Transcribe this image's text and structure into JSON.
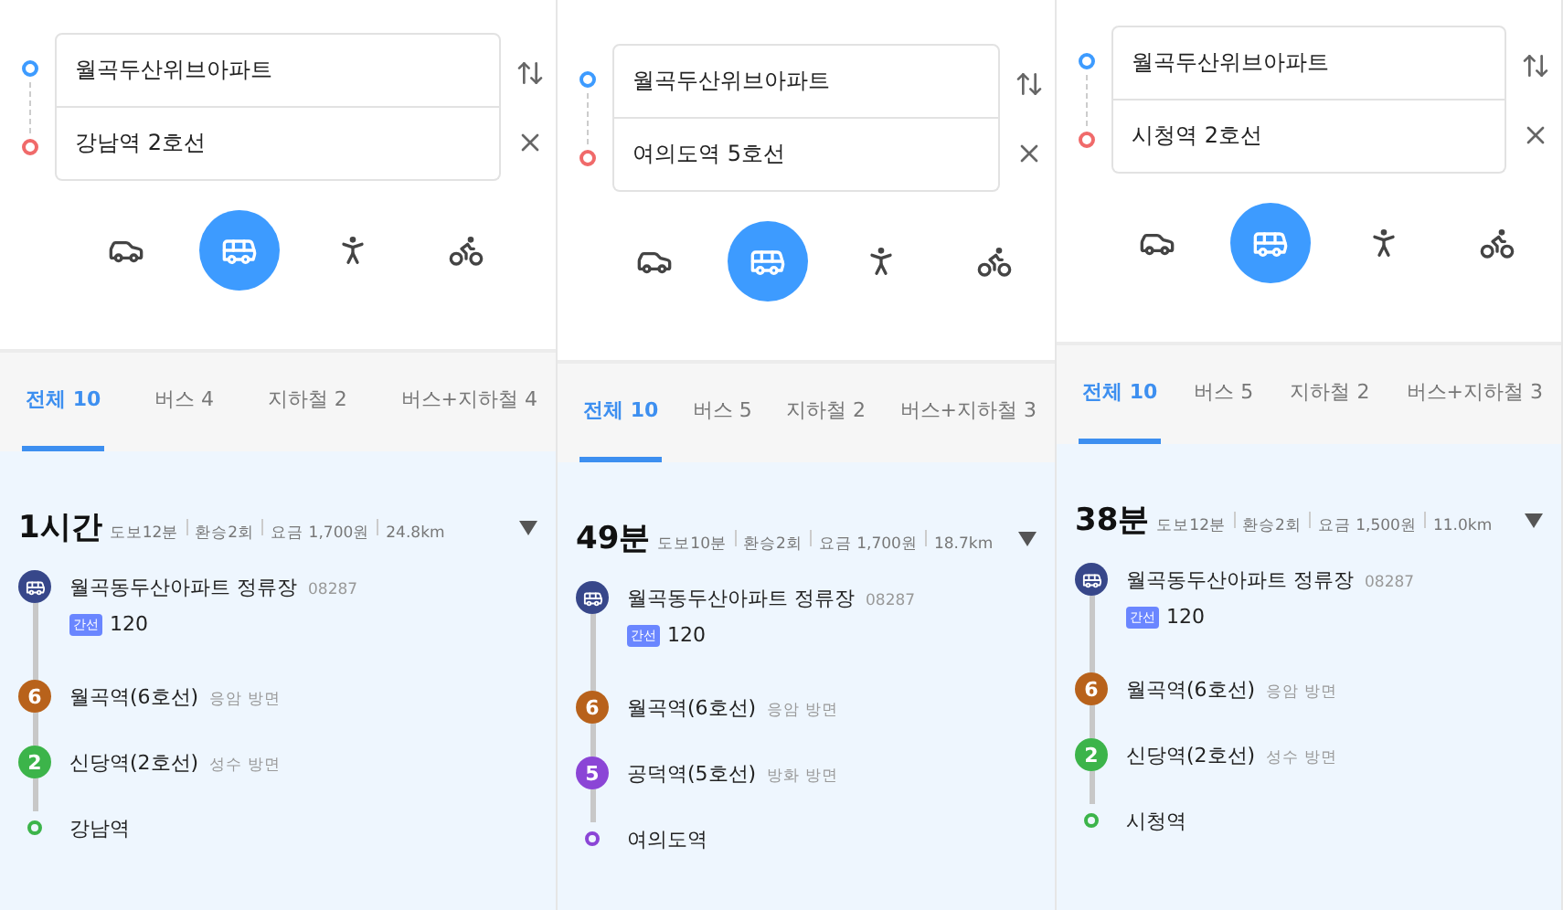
{
  "panels": [
    {
      "origin": "월곡두산위브아파트",
      "destination": "강남역 2호선",
      "modes": [
        {
          "kind": "car",
          "selected": false
        },
        {
          "kind": "transit",
          "selected": true
        },
        {
          "kind": "walk",
          "selected": false
        },
        {
          "kind": "bike",
          "selected": false
        }
      ],
      "tabs": [
        {
          "label": "전체 10",
          "selected": true
        },
        {
          "label": "버스 4",
          "selected": false
        },
        {
          "label": "지하철 2",
          "selected": false
        },
        {
          "label": "버스+지하철 4",
          "selected": false
        }
      ],
      "route": {
        "duration": "1시간",
        "details": [
          "도보12분",
          "환승2회",
          "요금 1,700원",
          "24.8km"
        ],
        "steps": [
          {
            "kind": "bus",
            "name": "월곡동두산아파트 정류장",
            "code": "08287",
            "badge": "간선",
            "number": "120",
            "color": "#37478a"
          },
          {
            "kind": "subway",
            "line": "6",
            "name": "월곡역(6호선)",
            "direction": "응암 방면",
            "color": "#b8621b"
          },
          {
            "kind": "subway",
            "line": "2",
            "name": "신당역(2호선)",
            "direction": "성수 방면",
            "color": "#3cb44a"
          },
          {
            "kind": "end",
            "name": "강남역",
            "color": "#3cb44a"
          }
        ]
      }
    },
    {
      "origin": "월곡두산위브아파트",
      "destination": "여의도역 5호선",
      "modes": [
        {
          "kind": "car",
          "selected": false
        },
        {
          "kind": "transit",
          "selected": true
        },
        {
          "kind": "walk",
          "selected": false
        },
        {
          "kind": "bike",
          "selected": false
        }
      ],
      "tabs": [
        {
          "label": "전체 10",
          "selected": true
        },
        {
          "label": "버스 5",
          "selected": false
        },
        {
          "label": "지하철 2",
          "selected": false
        },
        {
          "label": "버스+지하철 3",
          "selected": false
        }
      ],
      "route": {
        "duration": "49분",
        "details": [
          "도보10분",
          "환승2회",
          "요금 1,700원",
          "18.7km"
        ],
        "steps": [
          {
            "kind": "bus",
            "name": "월곡동두산아파트 정류장",
            "code": "08287",
            "badge": "간선",
            "number": "120",
            "color": "#37478a"
          },
          {
            "kind": "subway",
            "line": "6",
            "name": "월곡역(6호선)",
            "direction": "응암 방면",
            "color": "#b8621b"
          },
          {
            "kind": "subway",
            "line": "5",
            "name": "공덕역(5호선)",
            "direction": "방화 방면",
            "color": "#8b45d6"
          },
          {
            "kind": "end",
            "name": "여의도역",
            "color": "#8b45d6"
          }
        ]
      }
    },
    {
      "origin": "월곡두산위브아파트",
      "destination": "시청역 2호선",
      "modes": [
        {
          "kind": "car",
          "selected": false
        },
        {
          "kind": "transit",
          "selected": true
        },
        {
          "kind": "walk",
          "selected": false
        },
        {
          "kind": "bike",
          "selected": false
        }
      ],
      "tabs": [
        {
          "label": "전체 10",
          "selected": true
        },
        {
          "label": "버스 5",
          "selected": false
        },
        {
          "label": "지하철 2",
          "selected": false
        },
        {
          "label": "버스+지하철 3",
          "selected": false
        }
      ],
      "route": {
        "duration": "38분",
        "details": [
          "도보12분",
          "환승2회",
          "요금 1,500원",
          "11.0km"
        ],
        "steps": [
          {
            "kind": "bus",
            "name": "월곡동두산아파트 정류장",
            "code": "08287",
            "badge": "간선",
            "number": "120",
            "color": "#37478a"
          },
          {
            "kind": "subway",
            "line": "6",
            "name": "월곡역(6호선)",
            "direction": "응암 방면",
            "color": "#b8621b"
          },
          {
            "kind": "subway",
            "line": "2",
            "name": "신당역(2호선)",
            "direction": "성수 방면",
            "color": "#3cb44a"
          },
          {
            "kind": "end",
            "name": "시청역",
            "color": "#3cb44a"
          }
        ]
      }
    }
  ]
}
